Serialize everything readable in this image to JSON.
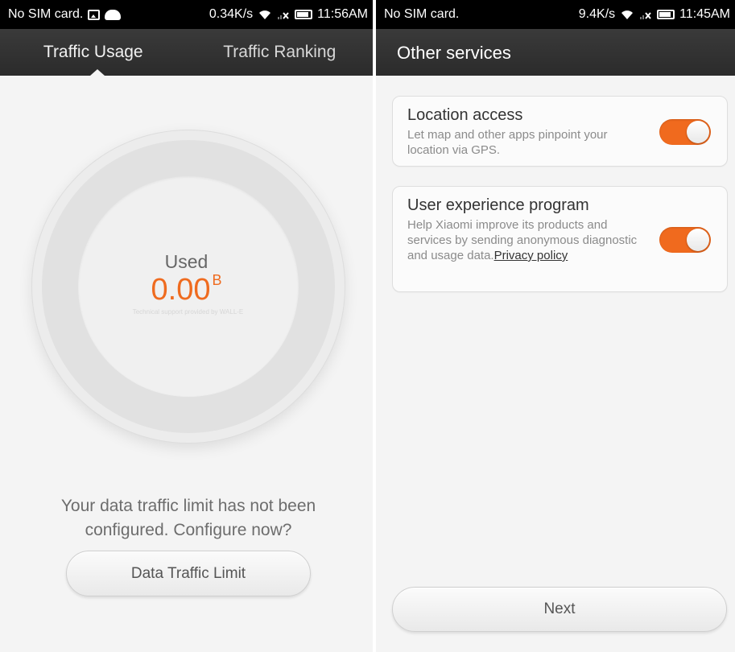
{
  "left": {
    "statusbar": {
      "carrier": "No SIM card.",
      "speed": "0.34K/s",
      "time": "11:56AM"
    },
    "tabs": [
      {
        "label": "Traffic Usage"
      },
      {
        "label": "Traffic Ranking"
      }
    ],
    "usage": {
      "label": "Used",
      "value": "0.00",
      "unit": "B",
      "support": "Technical support provided by WALL-E"
    },
    "prompt": "Your data traffic limit has not been configured. Configure now?",
    "button": "Data Traffic Limit"
  },
  "right": {
    "statusbar": {
      "carrier": "No SIM card.",
      "speed": "9.4K/s",
      "time": "11:45AM"
    },
    "title": "Other services",
    "cards": [
      {
        "title": "Location access",
        "description": "Let map and other apps pinpoint your location via GPS.",
        "enabled": true
      },
      {
        "title": "User experience program",
        "description": "Help Xiaomi improve its products and services by sending anonymous diagnostic and usage data.",
        "link": "Privacy policy",
        "enabled": true
      }
    ],
    "button": "Next"
  },
  "colors": {
    "accent": "#ef6b1f",
    "toggle_on": "#f06a1e",
    "titlebar": "#2f2f2f"
  },
  "icons": [
    "photo-icon",
    "android-icon",
    "wifi-icon",
    "no-signal-icon",
    "battery-icon"
  ]
}
